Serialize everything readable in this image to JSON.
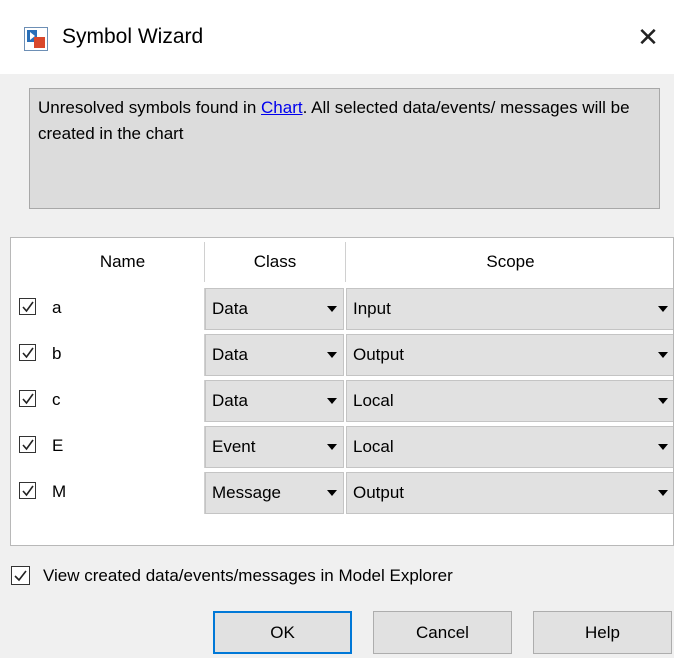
{
  "window": {
    "title": "Symbol Wizard",
    "close_glyph": "✕"
  },
  "message": {
    "prefix": "Unresolved symbols found in ",
    "link": "Chart",
    "suffix": ". All selected data/events/ messages will be created in the chart"
  },
  "table": {
    "headers": {
      "name": "Name",
      "class": "Class",
      "scope": "Scope"
    },
    "rows": [
      {
        "checked": true,
        "name": "a",
        "class": "Data",
        "scope": "Input"
      },
      {
        "checked": true,
        "name": "b",
        "class": "Data",
        "scope": "Output"
      },
      {
        "checked": true,
        "name": "c",
        "class": "Data",
        "scope": "Local"
      },
      {
        "checked": true,
        "name": "E",
        "class": "Event",
        "scope": "Local"
      },
      {
        "checked": true,
        "name": "M",
        "class": "Message",
        "scope": "Output"
      }
    ]
  },
  "options": {
    "view_in_explorer_label": "View created data/events/messages in Model Explorer",
    "view_in_explorer_checked": true
  },
  "buttons": {
    "ok": "OK",
    "cancel": "Cancel",
    "help": "Help"
  },
  "colors": {
    "link": "#0000ee",
    "focus": "#0078d7",
    "icon_blue": "#2a6fb8",
    "icon_red": "#d9482b"
  },
  "icons": {
    "app": "symbol-wizard-icon",
    "close": "close-icon",
    "check": "checkmark-icon",
    "dropdown": "chevron-down-icon"
  }
}
